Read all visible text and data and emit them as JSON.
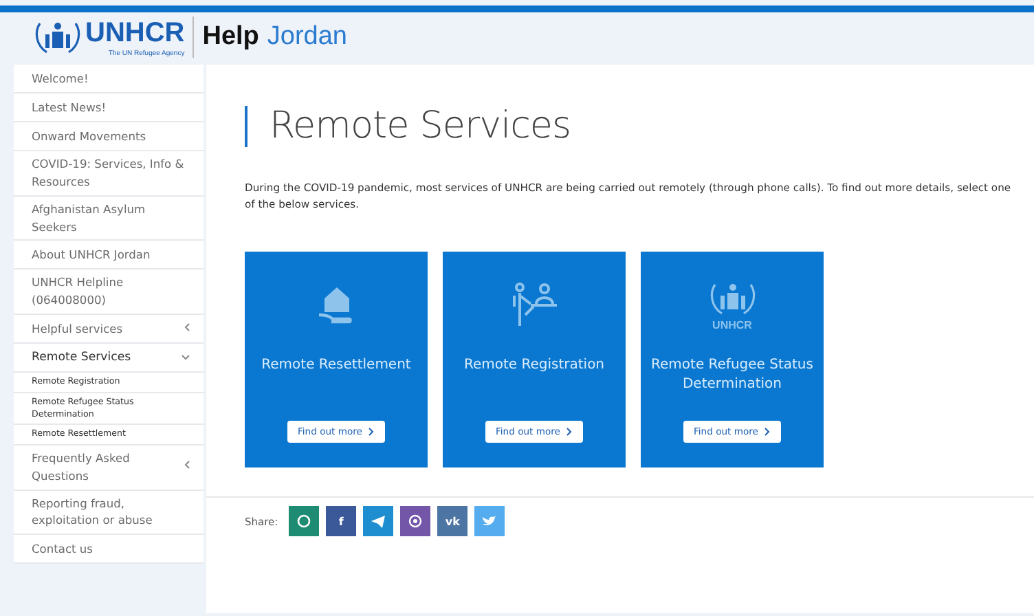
{
  "header": {
    "logo_text": "UNHCR",
    "logo_tagline": "The UN Refugee Agency",
    "title": "Help",
    "subtitle": "Jordan"
  },
  "sidebar": {
    "items": [
      {
        "label": "Welcome!",
        "selected": false
      },
      {
        "label": "Latest News!",
        "selected": false
      },
      {
        "label": "Onward Movements",
        "selected": false
      },
      {
        "label": "COVID-19: Services, Info & Resources",
        "selected": false
      },
      {
        "label": "Afghanistan Asylum Seekers",
        "selected": false
      },
      {
        "label": "About UNHCR Jordan",
        "selected": false
      },
      {
        "label": "UNHCR Helpline (064008000)",
        "selected": false
      },
      {
        "label": "Helpful services",
        "selected": false,
        "expanded": false
      },
      {
        "label": "Remote Services",
        "selected": true,
        "expanded": true,
        "children": [
          {
            "label": "Remote Registration"
          },
          {
            "label": "Remote Refugee Status Determination"
          },
          {
            "label": "Remote Resettlement"
          }
        ]
      },
      {
        "label": "Frequently Asked Questions",
        "selected": false,
        "expanded": false
      },
      {
        "label": "Reporting fraud, exploitation or abuse",
        "selected": false
      },
      {
        "label": "Contact us",
        "selected": false
      }
    ]
  },
  "main": {
    "title": "Remote Services",
    "intro": "During the COVID-19 pandemic, most services of UNHCR are being carried out remotely (through phone calls). To find out more details, select one of the below services.",
    "cards": [
      {
        "kind": "house",
        "title": "Remote Resettlement",
        "button": "Find out more"
      },
      {
        "kind": "people",
        "title": "Remote Registration",
        "button": "Find out more"
      },
      {
        "kind": "logo",
        "logo_text": "UNHCR",
        "title": "Remote Refugee Status Determination",
        "button": "Find out more"
      }
    ],
    "share": {
      "label": "Share:",
      "buttons": [
        {
          "kind": "chat",
          "color": "#1e8c72"
        },
        {
          "kind": "text",
          "label": "f",
          "color": "#3b5998"
        },
        {
          "kind": "plane",
          "color": "#1f8ed0"
        },
        {
          "kind": "phone",
          "color": "#7456a8"
        },
        {
          "kind": "text",
          "label": "vk",
          "color": "#4c75a3"
        },
        {
          "kind": "bird",
          "color": "#55acee"
        }
      ]
    }
  }
}
